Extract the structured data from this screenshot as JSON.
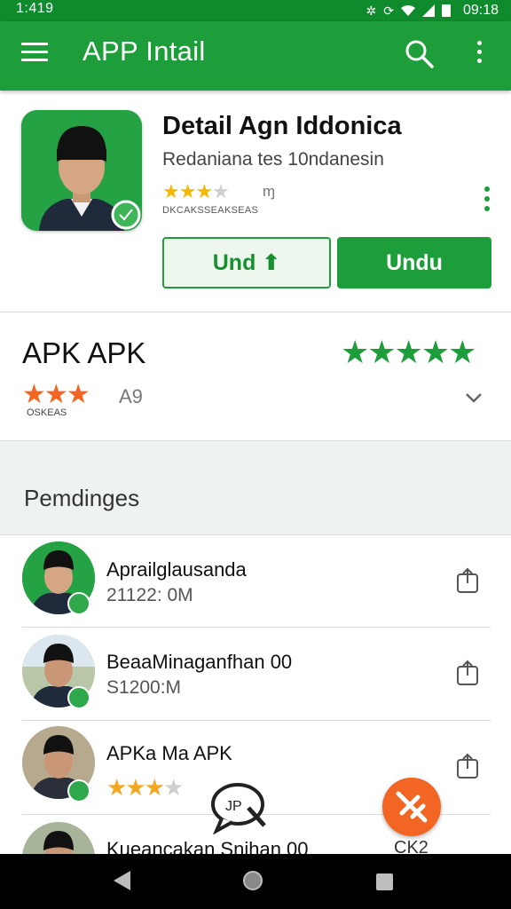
{
  "status_bar": {
    "left_time": "1:419",
    "right_time": "09:18"
  },
  "app_bar": {
    "title": "APP Intail",
    "menu_icon": "hamburger-menu-icon",
    "search_icon": "search-icon",
    "more_icon": "more-vert-icon"
  },
  "app": {
    "name": "Detail Agn Iddonica",
    "developer": "Redaniana tes 10ndanesin",
    "stars": "★★★★★",
    "rating_text": "ɱ",
    "meta": "DKCAKSSEAKSEAS",
    "primary_button": "Undu",
    "secondary_button": "Und ⬆"
  },
  "rating_section": {
    "title": "APK APK",
    "big_stars": "★★★★★",
    "orange_stars": "★★★",
    "count": "A9",
    "sub": "OSKEAS"
  },
  "section": {
    "title": "Pemdinges"
  },
  "list": [
    {
      "title": "Aprailglausanda",
      "sub": "21122: 0M"
    },
    {
      "title": "BeaaMinaganfhan 00",
      "sub": "S1200:M"
    },
    {
      "title": "APKa Ma APK",
      "stars": "★★★★"
    },
    {
      "title": "Kueancakan Snihan 00",
      "extra": "CK2"
    }
  ],
  "colors": {
    "primary": "#1e9e3a",
    "dark_primary": "#0f8a2c",
    "accent": "#f26522"
  }
}
